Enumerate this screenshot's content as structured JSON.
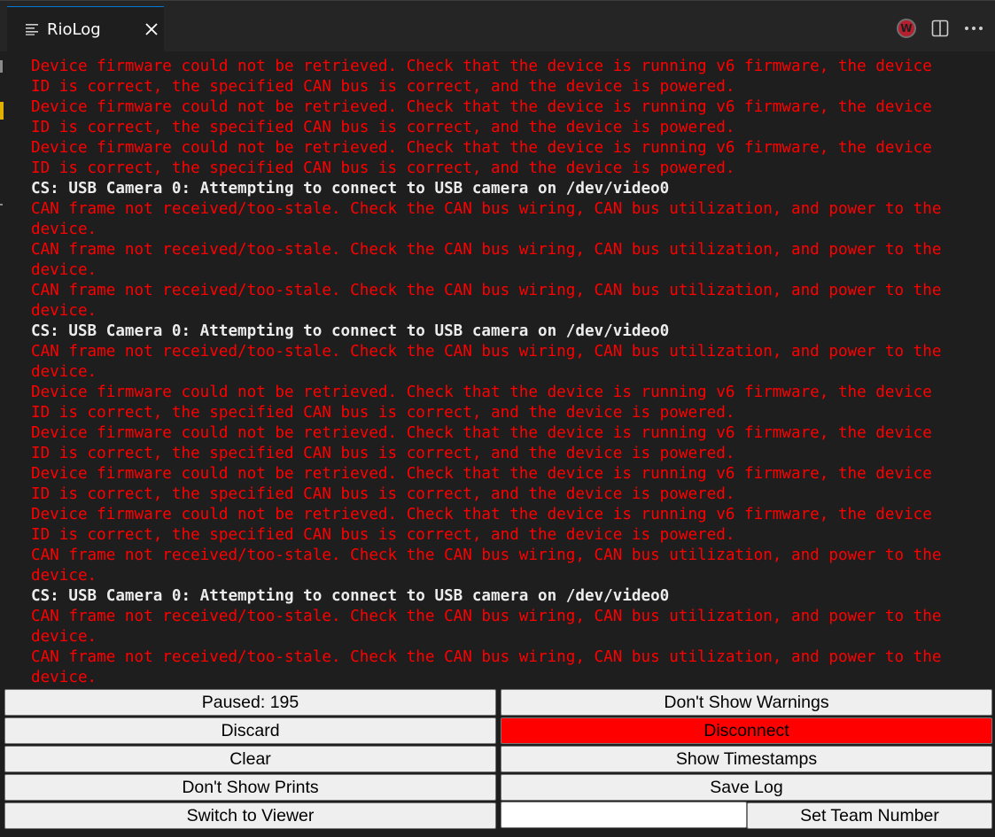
{
  "tab": {
    "title": "RioLog",
    "icon": "list-lines-icon"
  },
  "toolbar": {
    "wpilib_badge": "W",
    "actions": [
      "wpilib-icon",
      "split-editor-icon",
      "more-actions-icon"
    ]
  },
  "colors": {
    "error_text": "#ff0000",
    "info_text": "#ececec",
    "disconnect_bg": "#ff0000",
    "tab_accent": "#0078d4"
  },
  "log_lines": [
    {
      "type": "err",
      "text": "device."
    },
    {
      "type": "err",
      "text": "Device firmware could not be retrieved. Check that the device is running v6 firmware, the device"
    },
    {
      "type": "err",
      "text": "ID is correct, the specified CAN bus is correct, and the device is powered."
    },
    {
      "type": "err",
      "text": "Device firmware could not be retrieved. Check that the device is running v6 firmware, the device"
    },
    {
      "type": "err",
      "text": "ID is correct, the specified CAN bus is correct, and the device is powered."
    },
    {
      "type": "err",
      "text": "Device firmware could not be retrieved. Check that the device is running v6 firmware, the device"
    },
    {
      "type": "err",
      "text": "ID is correct, the specified CAN bus is correct, and the device is powered."
    },
    {
      "type": "info",
      "text": "CS: USB Camera 0: Attempting to connect to USB camera on /dev/video0"
    },
    {
      "type": "err",
      "text": "CAN frame not received/too-stale. Check the CAN bus wiring, CAN bus utilization, and power to the"
    },
    {
      "type": "err",
      "text": "device."
    },
    {
      "type": "err",
      "text": "CAN frame not received/too-stale. Check the CAN bus wiring, CAN bus utilization, and power to the"
    },
    {
      "type": "err",
      "text": "device."
    },
    {
      "type": "err",
      "text": "CAN frame not received/too-stale. Check the CAN bus wiring, CAN bus utilization, and power to the"
    },
    {
      "type": "err",
      "text": "device."
    },
    {
      "type": "info",
      "text": "CS: USB Camera 0: Attempting to connect to USB camera on /dev/video0"
    },
    {
      "type": "err",
      "text": "CAN frame not received/too-stale. Check the CAN bus wiring, CAN bus utilization, and power to the"
    },
    {
      "type": "err",
      "text": "device."
    },
    {
      "type": "err",
      "text": "Device firmware could not be retrieved. Check that the device is running v6 firmware, the device"
    },
    {
      "type": "err",
      "text": "ID is correct, the specified CAN bus is correct, and the device is powered."
    },
    {
      "type": "err",
      "text": "Device firmware could not be retrieved. Check that the device is running v6 firmware, the device"
    },
    {
      "type": "err",
      "text": "ID is correct, the specified CAN bus is correct, and the device is powered."
    },
    {
      "type": "err",
      "text": "Device firmware could not be retrieved. Check that the device is running v6 firmware, the device"
    },
    {
      "type": "err",
      "text": "ID is correct, the specified CAN bus is correct, and the device is powered."
    },
    {
      "type": "err",
      "text": "Device firmware could not be retrieved. Check that the device is running v6 firmware, the device"
    },
    {
      "type": "err",
      "text": "ID is correct, the specified CAN bus is correct, and the device is powered."
    },
    {
      "type": "err",
      "text": "CAN frame not received/too-stale. Check the CAN bus wiring, CAN bus utilization, and power to the"
    },
    {
      "type": "err",
      "text": "device."
    },
    {
      "type": "info",
      "text": "CS: USB Camera 0: Attempting to connect to USB camera on /dev/video0"
    },
    {
      "type": "err",
      "text": "CAN frame not received/too-stale. Check the CAN bus wiring, CAN bus utilization, and power to the"
    },
    {
      "type": "err",
      "text": "device."
    },
    {
      "type": "err",
      "text": "CAN frame not received/too-stale. Check the CAN bus wiring, CAN bus utilization, and power to the"
    },
    {
      "type": "err",
      "text": "device."
    }
  ],
  "buttons": {
    "paused": "Paused: 195",
    "discard": "Discard",
    "clear": "Clear",
    "dont_show_prints": "Don't Show Prints",
    "switch_to_viewer": "Switch to Viewer",
    "dont_show_warnings": "Don't Show Warnings",
    "disconnect": "Disconnect",
    "show_timestamps": "Show Timestamps",
    "save_log": "Save Log",
    "set_team_number": "Set Team Number"
  },
  "team_number_input": {
    "value": "",
    "placeholder": ""
  }
}
